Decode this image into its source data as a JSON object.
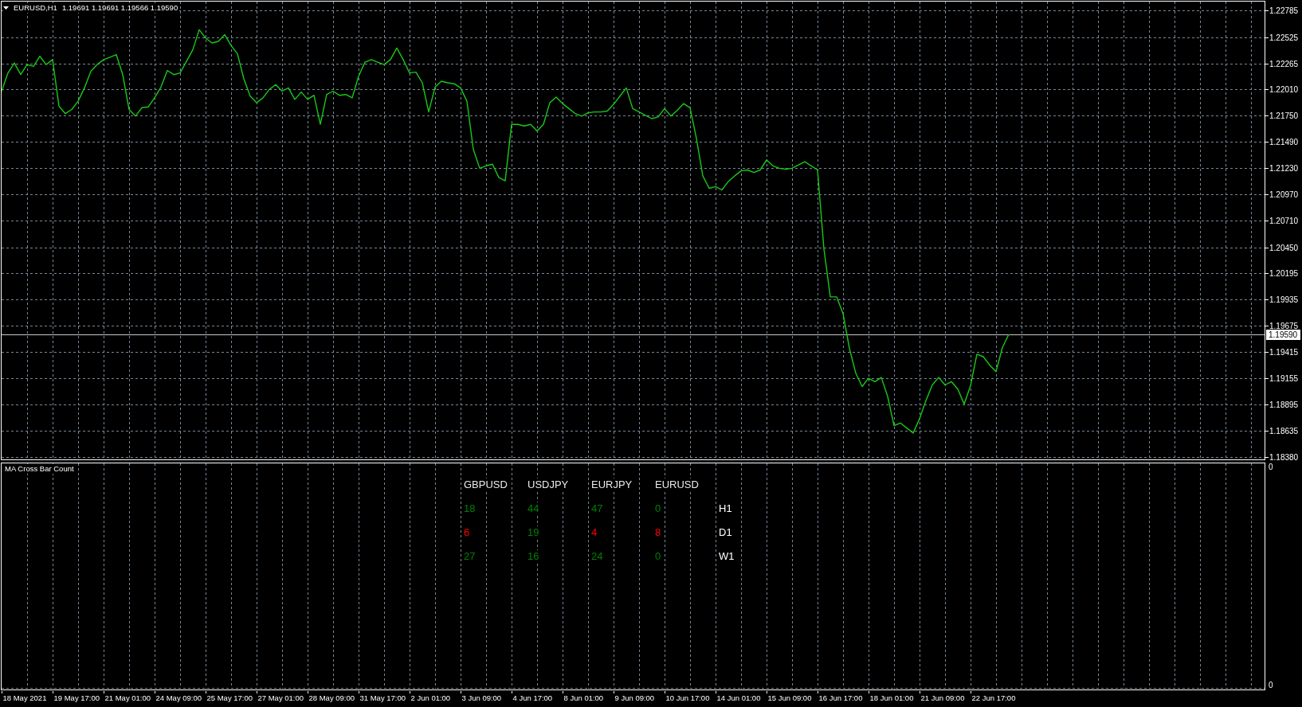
{
  "chart": {
    "ohlc": "1.19691 1.19691 1.19566 1.19590",
    "chart_data": {
      "type": "line",
      "title": "EURUSD,H1",
      "categories": [
        null,
        null,
        null,
        null,
        null,
        null,
        null,
        null,
        null,
        null,
        null,
        null,
        null,
        null,
        null,
        null,
        null,
        null,
        null,
        null,
        null,
        null,
        null,
        null,
        null,
        null,
        null,
        null,
        null,
        null,
        null,
        null,
        null,
        null,
        null,
        null,
        null,
        null,
        null,
        null,
        null,
        null,
        null,
        null,
        null,
        null,
        null,
        null,
        null,
        null,
        null,
        null,
        null,
        null,
        null,
        null,
        null,
        null,
        null,
        null,
        null,
        null,
        null,
        null,
        null,
        null,
        null,
        null,
        null,
        null,
        null,
        null,
        null,
        null,
        null,
        null,
        null,
        null,
        null,
        null,
        null,
        null,
        null,
        null,
        null,
        null,
        null,
        null,
        null,
        null,
        null,
        null,
        null,
        null,
        null,
        null,
        null,
        null,
        null,
        null,
        null,
        null,
        null,
        null,
        null,
        null,
        null,
        null,
        null,
        null,
        null,
        null,
        null,
        null,
        null,
        null,
        null,
        null,
        null,
        null,
        null,
        null,
        null,
        null,
        null,
        null,
        null,
        null,
        null,
        null,
        null,
        null,
        null,
        null,
        null,
        null,
        null,
        null,
        null,
        null,
        null,
        null,
        null,
        null,
        null,
        null,
        null,
        null,
        null,
        null,
        null,
        null,
        null,
        null,
        null,
        null,
        null,
        null,
        null
      ],
      "series": [
        {
          "color": "#19c819",
          "values": [
            1.21991,
            1.22171,
            1.22269,
            1.22154,
            1.22253,
            1.22236,
            1.22335,
            1.22253,
            1.22302,
            1.21843,
            1.21769,
            1.2181,
            1.21892,
            1.22023,
            1.22187,
            1.22253,
            1.22302,
            1.22326,
            1.22351,
            1.22154,
            1.2181,
            1.21745,
            1.21827,
            1.21835,
            1.21925,
            1.22032,
            1.22195,
            1.22154,
            1.22171,
            1.22285,
            1.224,
            1.22597,
            1.22515,
            1.22466,
            1.22482,
            1.22548,
            1.22441,
            1.22359,
            1.22113,
            1.21941,
            1.21876,
            1.21925,
            1.22007,
            1.22056,
            1.21991,
            1.22023,
            1.21909,
            1.21982,
            1.21909,
            1.2195,
            1.21663,
            1.21958,
            1.21991,
            1.2195,
            1.21958,
            1.21925,
            1.22138,
            1.22277,
            1.22302,
            1.22277,
            1.22253,
            1.22302,
            1.22417,
            1.22302,
            1.22171,
            1.22179,
            1.22073,
            1.21786,
            1.22032,
            1.22089,
            1.22073,
            1.22064,
            1.22023,
            1.21892,
            1.21417,
            1.21229,
            1.21254,
            1.2127,
            1.21139,
            1.21106,
            1.21663,
            1.21663,
            1.21647,
            1.21663,
            1.21598,
            1.21663,
            1.21876,
            1.21933,
            1.21868,
            1.21819,
            1.21769,
            1.21745,
            1.21778,
            1.21786,
            1.21786,
            1.21794,
            1.2186,
            1.21941,
            1.22023,
            1.21819,
            1.21786,
            1.21753,
            1.2172,
            1.21737,
            1.21819,
            1.21745,
            1.21802,
            1.21868,
            1.21827,
            1.21524,
            1.21155,
            1.21032,
            1.21049,
            1.21016,
            1.21098,
            1.21155,
            1.21204,
            1.21213,
            1.21188,
            1.21213,
            1.21311,
            1.21254,
            1.21229,
            1.21221,
            1.21229,
            1.21262,
            1.21294,
            1.21254,
            1.21213,
            1.20435,
            1.1996,
            1.1996,
            1.19796,
            1.19452,
            1.19206,
            1.19075,
            1.19157,
            1.19124,
            1.19165,
            1.18977,
            1.1869,
            1.18715,
            1.18666,
            1.18616,
            1.18756,
            1.18936,
            1.19091,
            1.19165,
            1.19091,
            1.19124,
            1.1905,
            1.18903,
            1.19083,
            1.19394,
            1.1937,
            1.19288,
            1.19222,
            1.1946,
            1.1959
          ]
        }
      ],
      "ylim": [
        1.18356,
        1.22875
      ],
      "yticks": [
        {
          "value": 1.22785,
          "label": "1.22785"
        },
        {
          "value": 1.22525,
          "label": "1.22525"
        },
        {
          "value": 1.22265,
          "label": "1.22265"
        },
        {
          "value": 1.2201,
          "label": "1.22010"
        },
        {
          "value": 1.2175,
          "label": "1.21750"
        },
        {
          "value": 1.2149,
          "label": "1.21490"
        },
        {
          "value": 1.2123,
          "label": "1.21230"
        },
        {
          "value": 1.2097,
          "label": "1.20970"
        },
        {
          "value": 1.2071,
          "label": "1.20710"
        },
        {
          "value": 1.2045,
          "label": "1.20450"
        },
        {
          "value": 1.20195,
          "label": "1.20195"
        },
        {
          "value": 1.19935,
          "label": "1.19935"
        },
        {
          "value": 1.19675,
          "label": "1.19675"
        },
        {
          "value": 1.19415,
          "label": "1.19415"
        },
        {
          "value": 1.19155,
          "label": "1.19155"
        },
        {
          "value": 1.18895,
          "label": "1.18895"
        },
        {
          "value": 1.18635,
          "label": "1.18635"
        },
        {
          "value": 1.1838,
          "label": "1.18380"
        }
      ],
      "grid": true,
      "ref_lines": [
        {
          "axis": "y",
          "value": 1.1959,
          "label": "1.19590"
        }
      ]
    }
  },
  "indicator": {
    "name": "MA Cross Bar Count",
    "scale_labels": [
      "0",
      "0"
    ],
    "columns": [
      "GBPUSD",
      "USDJPY",
      "EURJPY",
      "EURUSD"
    ],
    "rows": [
      {
        "label": "H1",
        "cells": [
          {
            "value": "18",
            "color": "#008000"
          },
          {
            "value": "44",
            "color": "#008000"
          },
          {
            "value": "47",
            "color": "#008000"
          },
          {
            "value": "0",
            "color": "#008000"
          }
        ]
      },
      {
        "label": "D1",
        "cells": [
          {
            "value": "6",
            "color": "#ff0000"
          },
          {
            "value": "19",
            "color": "#008000"
          },
          {
            "value": "4",
            "color": "#ff0000"
          },
          {
            "value": "8",
            "color": "#ff0000"
          }
        ]
      },
      {
        "label": "W1",
        "cells": [
          {
            "value": "27",
            "color": "#008000"
          },
          {
            "value": "16",
            "color": "#008000"
          },
          {
            "value": "24",
            "color": "#008000"
          },
          {
            "value": "0",
            "color": "#008000"
          }
        ]
      }
    ]
  },
  "time_scale": [
    "18 May 2021",
    "19 May 17:00",
    "21 May 01:00",
    "24 May 09:00",
    "25 May 17:00",
    "27 May 01:00",
    "28 May 09:00",
    "31 May 17:00",
    "2 Jun 01:00",
    "3 Jun 09:00",
    "4 Jun 17:00",
    "8 Jun 01:00",
    "9 Jun 09:00",
    "10 Jun 17:00",
    "14 Jun 01:00",
    "15 Jun 09:00",
    "16 Jun 17:00",
    "18 Jun 01:00",
    "21 Jun 09:00",
    "22 Jun 17:00"
  ]
}
